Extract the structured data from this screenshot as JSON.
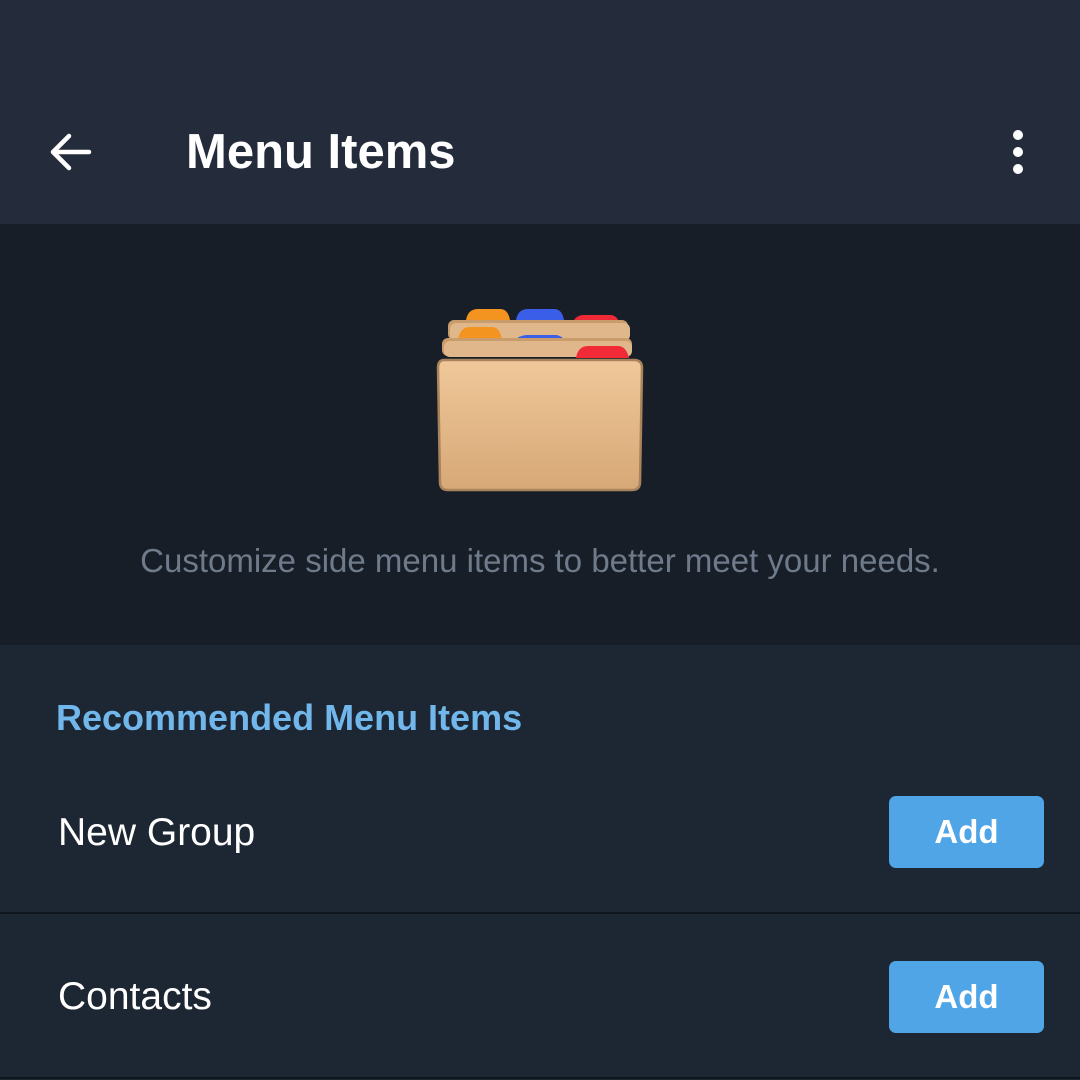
{
  "header": {
    "title": "Menu Items",
    "back_icon": "arrow-left-icon",
    "more_icon": "more-vert-icon"
  },
  "hero": {
    "illustration": "file-cabinet-folder-icon",
    "description": "Customize side menu items to better meet your needs."
  },
  "section": {
    "title": "Recommended Menu Items",
    "items": [
      {
        "label": "New Group",
        "button_label": "Add"
      },
      {
        "label": "Contacts",
        "button_label": "Add"
      }
    ]
  },
  "colors": {
    "header_bg": "#242c3b",
    "hero_bg": "#171e28",
    "body_bg": "#1d2733",
    "accent": "#72b7ec",
    "button_bg": "#50a5e6",
    "muted_text": "#6f7b8a",
    "divider": "#10161e"
  }
}
